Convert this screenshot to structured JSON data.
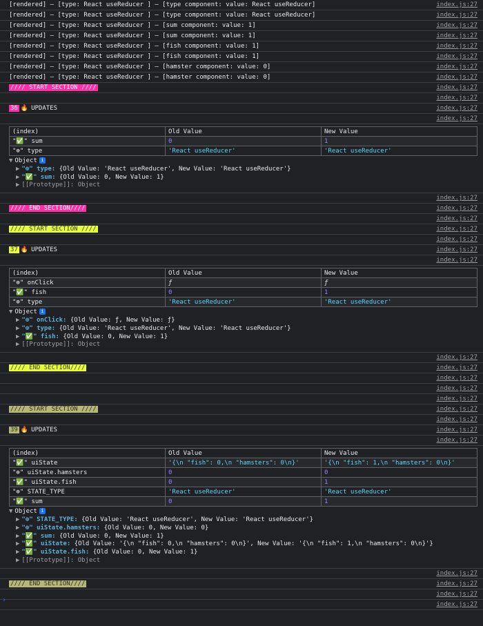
{
  "source": "index.js:27",
  "rendered_lines": [
    "[rendered] — [type: React useReducer ] — [type component: value: React useReducer]",
    "[rendered] — [type: React useReducer ] — [type component: value: React useReducer]",
    "[rendered] — [type: React useReducer ] — [sum component: value: 1]",
    "[rendered] — [type: React useReducer ] — [sum component: value: 1]",
    "[rendered] — [type: React useReducer ] — [fish component: value: 1]",
    "[rendered] — [type: React useReducer ] — [fish component: value: 1]",
    "[rendered] — [type: React useReducer ] — [hamster component: value: 0]",
    "[rendered] — [type: React useReducer ] — [hamster component: value: 0]"
  ],
  "labels": {
    "start_section": "//// START SECTION ////",
    "end_section": "//// END SECTION////",
    "updates": "UPDATES",
    "object": "Object",
    "prototype": "[[Prototype]]: Object",
    "fire": "🔥",
    "info": "i",
    "prompt": "›"
  },
  "table_header": [
    "(index)",
    "Old Value",
    "New Value"
  ],
  "sections": [
    {
      "color": "#ff2ea6",
      "count": "36",
      "rows": [
        {
          "index": "\"✅\" sum",
          "old": "0",
          "new": "1",
          "type": "num"
        },
        {
          "index": "\"⊕\" type",
          "old": "'React useReducer'",
          "new": "'React useReducer'",
          "type": "str"
        }
      ],
      "object_lines": [
        "\"⊕\" type: {Old Value: 'React useReducer', New Value: 'React useReducer'}",
        "\"✅\" sum: {Old Value: 0, New Value: 1}"
      ]
    },
    {
      "color": "#e6ff3a",
      "count": "37",
      "rows": [
        {
          "index": "\"⊕\" onClick",
          "old": "ƒ",
          "new": "ƒ",
          "type": "fn"
        },
        {
          "index": "\"✅\" fish",
          "old": "0",
          "new": "1",
          "type": "num"
        },
        {
          "index": "\"⊕\" type",
          "old": "'React useReducer'",
          "new": "'React useReducer'",
          "type": "str"
        }
      ],
      "object_lines": [
        "\"⊕\" onClick: {Old Value: ƒ, New Value: ƒ}",
        "\"⊕\" type: {Old Value: 'React useReducer', New Value: 'React useReducer'}",
        "\"✅\" fish: {Old Value: 0, New Value: 1}"
      ]
    },
    {
      "color": "#b6b87a",
      "count": "39",
      "rows": [
        {
          "index": "\"✅\" uiState",
          "old": "'{\\n \"fish\": 0,\\n \"hamsters\": 0\\n}'",
          "new": "'{\\n \"fish\": 1,\\n \"hamsters\": 0\\n}'",
          "type": "str"
        },
        {
          "index": "\"⊕\" uiState.hamsters",
          "old": "0",
          "new": "0",
          "type": "num"
        },
        {
          "index": "\"✅\" uiState.fish",
          "old": "0",
          "new": "1",
          "type": "num"
        },
        {
          "index": "\"⊕\" STATE_TYPE",
          "old": "'React useReducer'",
          "new": "'React useReducer'",
          "type": "str"
        },
        {
          "index": "\"✅\" sum",
          "old": "0",
          "new": "1",
          "type": "num"
        }
      ],
      "object_lines": [
        "\"⊕\" STATE_TYPE: {Old Value: 'React useReducer', New Value: 'React useReducer'}",
        "\"⊕\" uiState.hamsters: {Old Value: 0, New Value: 0}",
        "\"✅\" sum: {Old Value: 0, New Value: 1}",
        "\"✅\" uiState: {Old Value: '{\\n  \"fish\": 0,\\n  \"hamsters\": 0\\n}', New Value: '{\\n  \"fish\": 1,\\n  \"hamsters\": 0\\n}'}",
        "\"✅\" uiState.fish: {Old Value: 0, New Value: 1}"
      ]
    }
  ]
}
